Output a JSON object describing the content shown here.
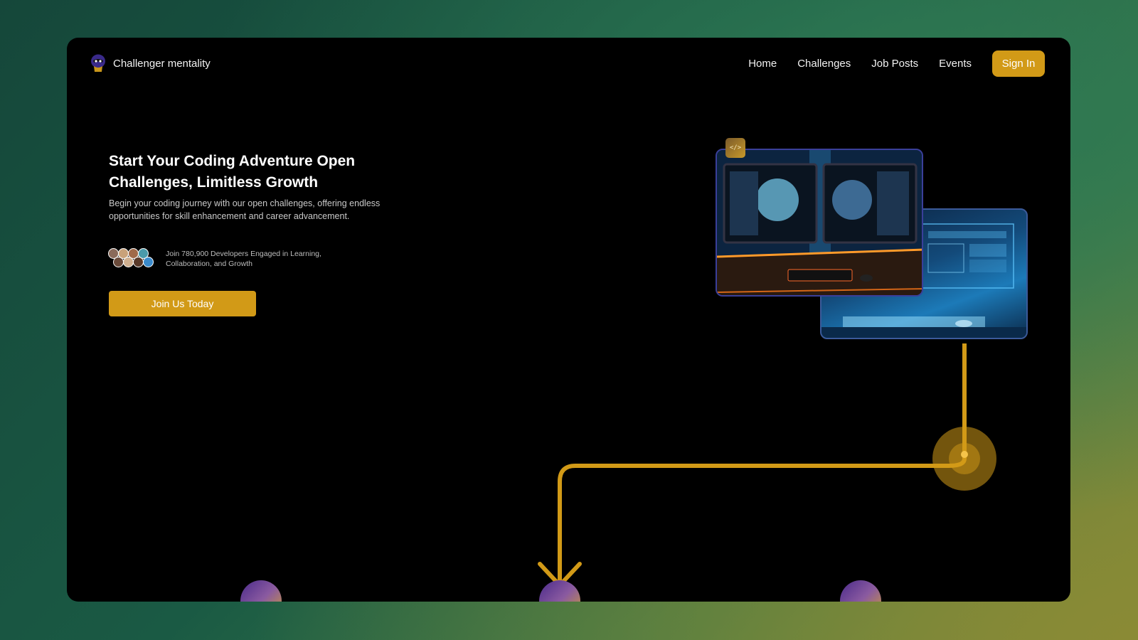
{
  "brand": {
    "name": "Challenger mentality",
    "logo_icon": "ninja-head-logo"
  },
  "nav": {
    "links": [
      "Home",
      "Challenges",
      "Job Posts",
      "Events"
    ],
    "signin_label": "Sign In"
  },
  "hero": {
    "title": "Start Your Coding Adventure Open Challenges, Limitless Growth",
    "subtitle": "Begin your coding journey with our open challenges, offering endless opportunities for skill enhancement and career advancement.",
    "community_text": "Join 780,900 Developers Engaged in Learning, Collaboration, and Growth",
    "cta_label": "Join Us Today"
  },
  "media": {
    "badge_text": "</>",
    "badge_icon": "code-icon",
    "front_image": "gaming-setup-image",
    "back_image": "monitor-interface-image"
  },
  "colors": {
    "accent": "#d29a17",
    "frame_bg": "#000000",
    "text": "#f2f2f2"
  }
}
